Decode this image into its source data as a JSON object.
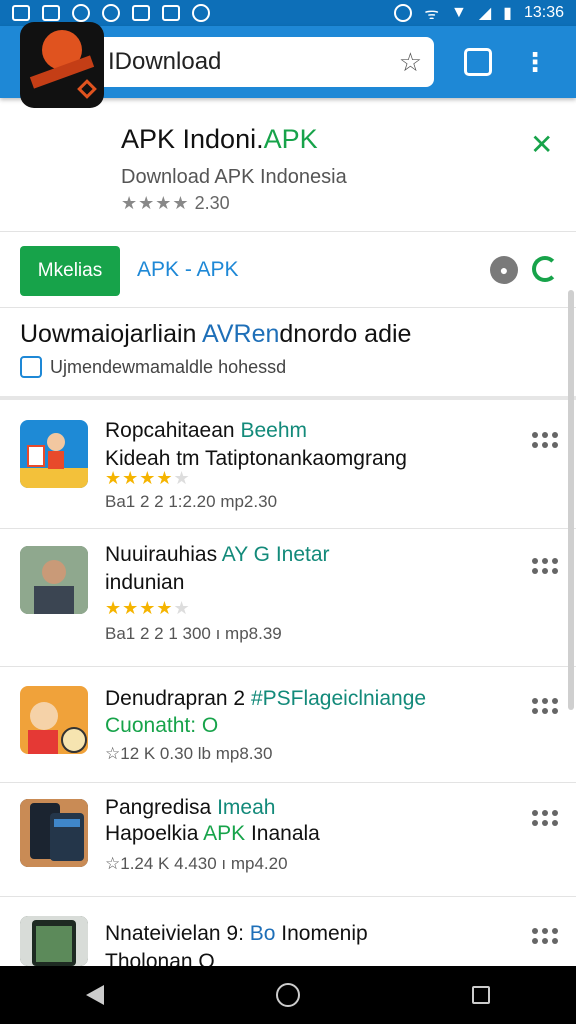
{
  "status_bar": {
    "time": "13:36"
  },
  "toolbar": {
    "url": "IDownload",
    "tab_count": ""
  },
  "app_header": {
    "title": "APK Indoni.",
    "title_tag": "APK",
    "subtitle": "Download  APK Indonesia",
    "stars": "★★★★",
    "rating": "2.30"
  },
  "actions": {
    "primary_label": "Mkelias",
    "link_label": "APK - APK"
  },
  "headline": {
    "text_a": "Uowmaiojarliain ",
    "text_b": "AVRen",
    "text_c": "dnordo adie",
    "sub": "Ujmendewmamaldle hohessd"
  },
  "items": [
    {
      "title": "Ropcahitaean",
      "tag": "Beehm",
      "line2": "Kideah tm Tatiptonankaomgrang",
      "line2_apk": "",
      "stars_on": "★★★★",
      "stars_off": "★",
      "meta": "Ba1 2 2  1:2.20  mp2.30",
      "colors": {
        "thumb_bg": "#1e8ad6"
      }
    },
    {
      "title": "Nuuirauhias",
      "tag": "AY G Inetar",
      "line2": "indunian",
      "line2_apk": "",
      "stars_on": "★★★★",
      "stars_off": "★",
      "meta": "Ba1 2 2  1 300 ı  mp8.39",
      "colors": {
        "thumb_bg": "#6b7f6a"
      }
    },
    {
      "title": "Denudrapran 2 ",
      "tag": "#PSFlageiclniange",
      "line2": "Cuonatht: O",
      "line2_apk": "",
      "stars_on": "",
      "stars_off": "",
      "meta": "☆12 K  0.30 lb  mp8.30",
      "colors": {
        "thumb_bg": "#f0a23a"
      }
    },
    {
      "title": "Pangredisa",
      "tag": "Imeah",
      "line2": "Hapoelkia ",
      "line2_apk": "APK",
      "line2_tail": " Inanala",
      "stars_on": "",
      "stars_off": "",
      "meta": "☆1.24 K  4.430 ı  mp4.20",
      "colors": {
        "thumb_bg": "#2d3b4a"
      }
    },
    {
      "title": "Nnateivielan 9: ",
      "tag": "Bo",
      "title_tail": " Inomenip",
      "line2": "Tholonan O",
      "colors": {
        "thumb_bg": "#3a4a3e"
      }
    }
  ]
}
